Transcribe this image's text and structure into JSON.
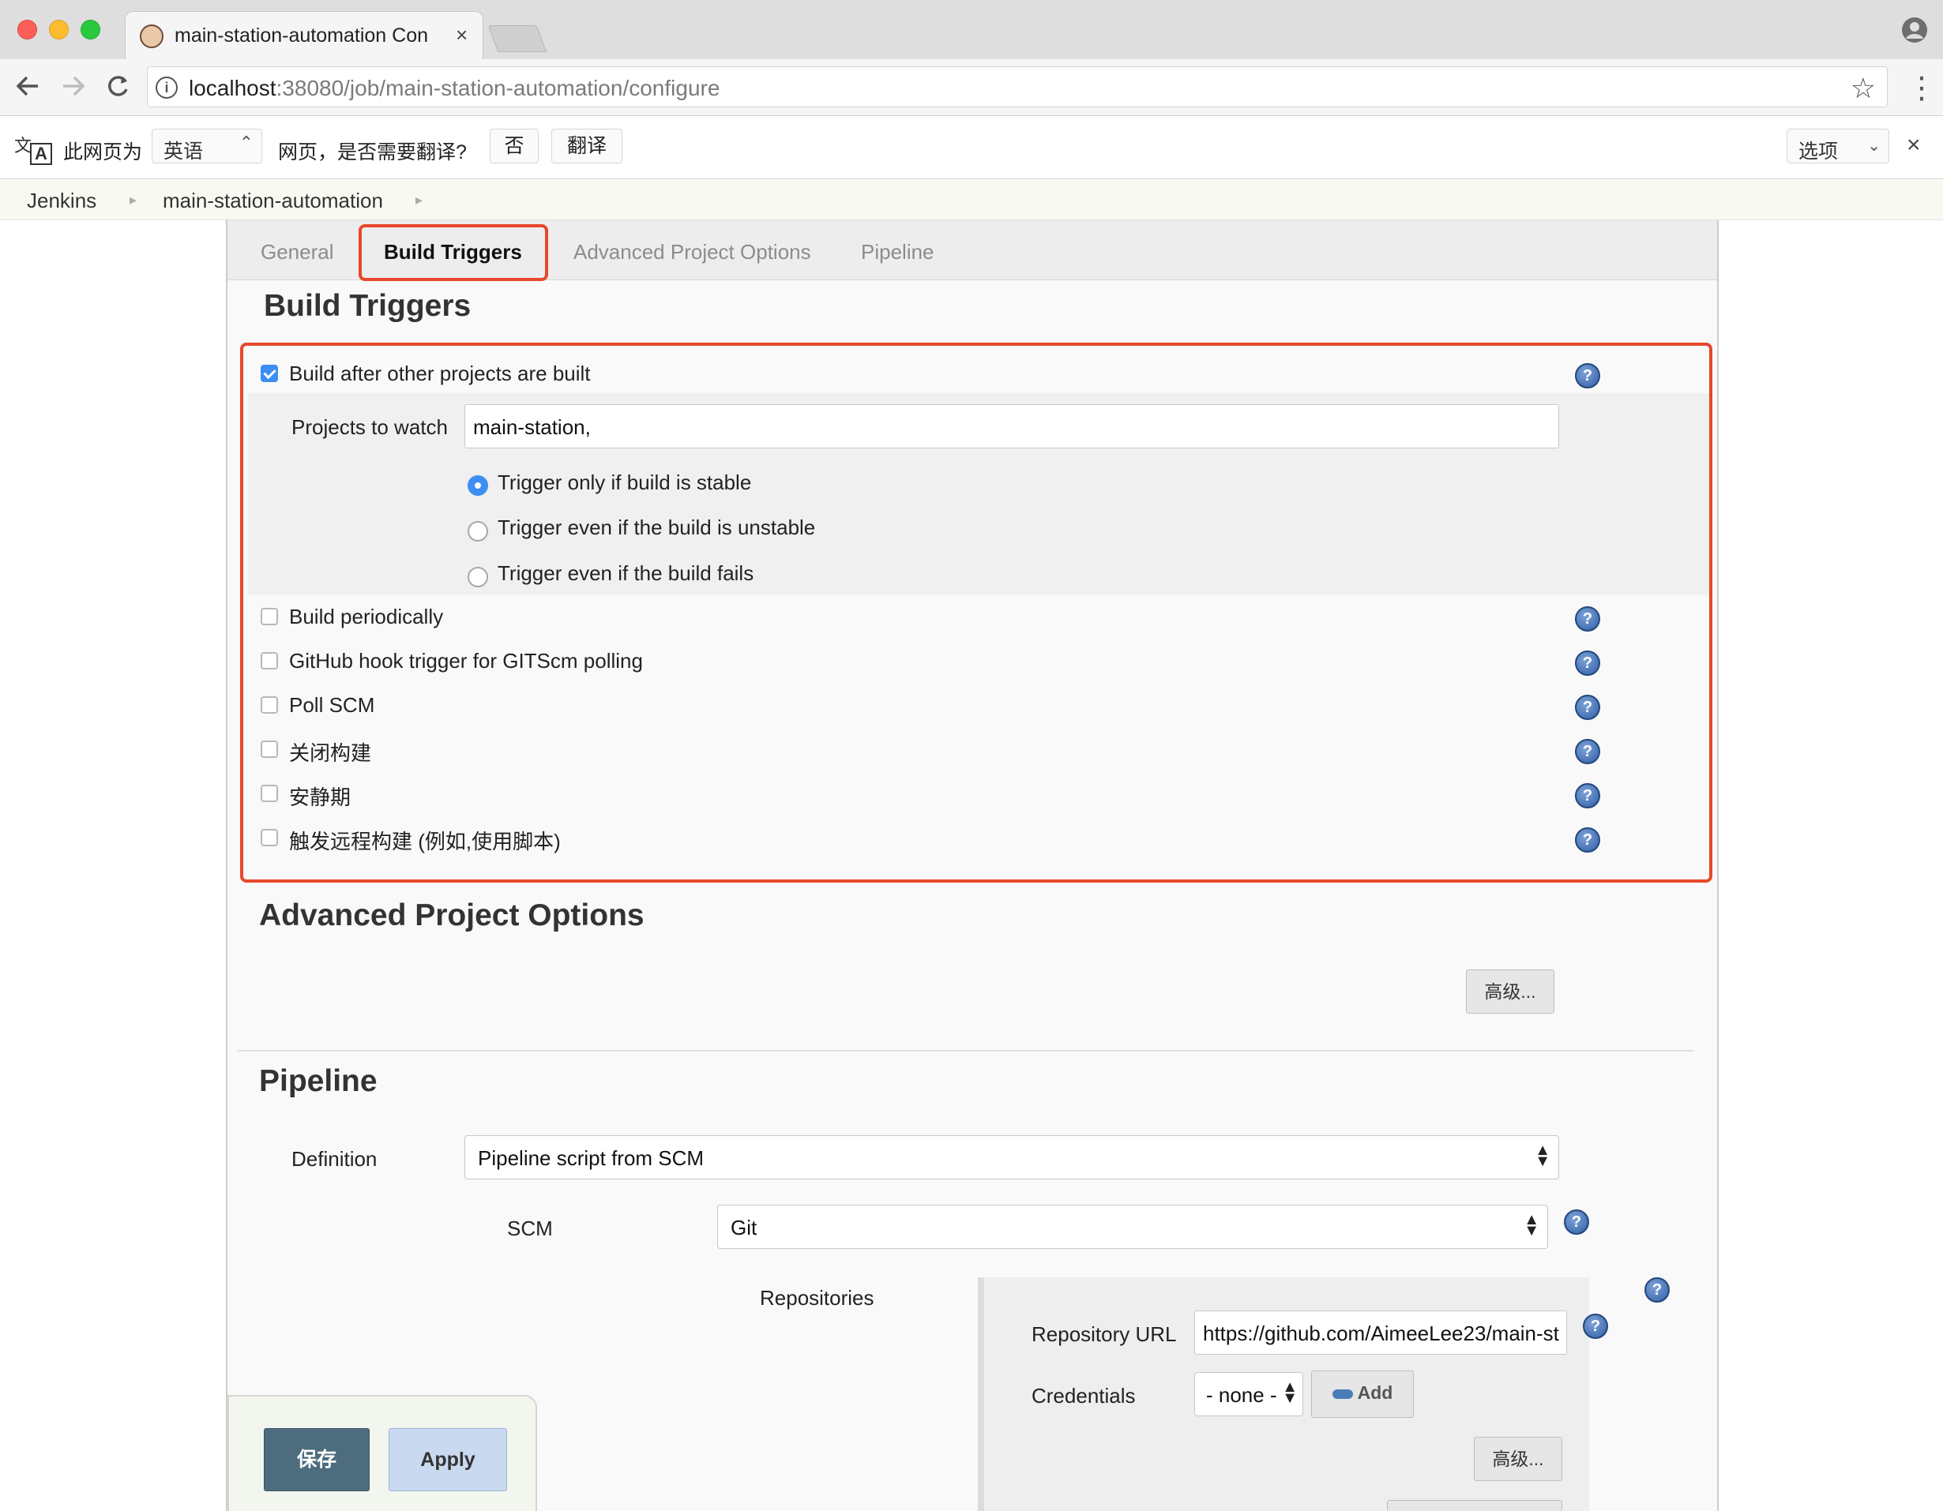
{
  "browser": {
    "tab_title": "main-station-automation Confi",
    "tab_close": "×",
    "url_host": "localhost",
    "url_rest": ":38080/job/main-station-automation/configure"
  },
  "translate_bar": {
    "prefix": "此网页为",
    "language": "英语",
    "question": "网页，是否需要翻译?",
    "no_label": "否",
    "translate_label": "翻译",
    "options_label": "选项"
  },
  "breadcrumb": {
    "items": [
      "Jenkins",
      "main-station-automation"
    ]
  },
  "config_tabs": [
    "General",
    "Build Triggers",
    "Advanced Project Options",
    "Pipeline"
  ],
  "build_triggers": {
    "title": "Build Triggers",
    "build_after": {
      "label": "Build after other projects are built",
      "checked": true,
      "projects_label": "Projects to watch",
      "projects_value": "main-station,",
      "options": [
        {
          "label": "Trigger only if build is stable",
          "selected": true
        },
        {
          "label": "Trigger even if the build is unstable",
          "selected": false
        },
        {
          "label": "Trigger even if the build fails",
          "selected": false
        }
      ]
    },
    "other_triggers": [
      {
        "label": "Build periodically",
        "checked": false
      },
      {
        "label": "GitHub hook trigger for GITScm polling",
        "checked": false
      },
      {
        "label": "Poll SCM",
        "checked": false
      },
      {
        "label": "关闭构建",
        "checked": false
      },
      {
        "label": "安静期",
        "checked": false
      },
      {
        "label": "触发远程构建 (例如,使用脚本)",
        "checked": false
      }
    ]
  },
  "advanced_options": {
    "title": "Advanced Project Options",
    "advanced_button": "高级..."
  },
  "pipeline": {
    "title": "Pipeline",
    "definition_label": "Definition",
    "definition_value": "Pipeline script from SCM",
    "scm_label": "SCM",
    "scm_value": "Git",
    "repositories_label": "Repositories",
    "repo_url_label": "Repository URL",
    "repo_url_value": "https://github.com/AimeeLee23/main-st",
    "credentials_label": "Credentials",
    "credentials_value": "- none -",
    "add_button": "Add",
    "advanced_button": "高级..."
  },
  "actions": {
    "save_label": "保存",
    "apply_label": "Apply"
  },
  "colors": {
    "highlight": "#e8472b",
    "checkbox_checked": "#3c8ef3",
    "save_button": "#4d6c7e",
    "apply_button": "#c9daf0"
  }
}
